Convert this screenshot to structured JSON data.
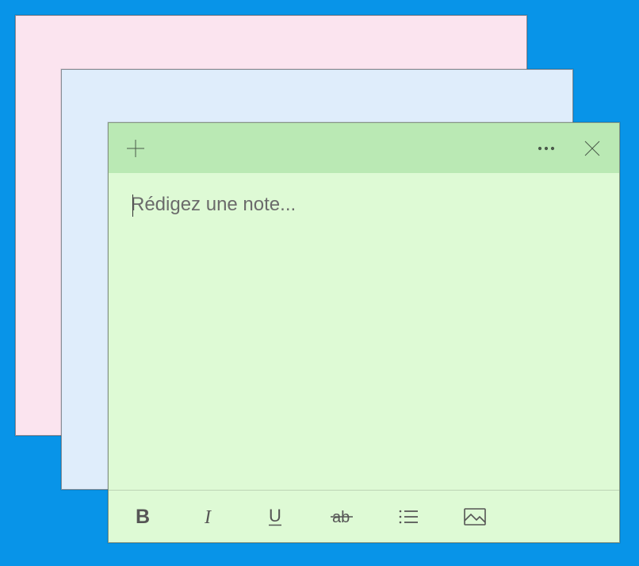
{
  "notes": {
    "back_pink": {
      "color": "#fbe4ef"
    },
    "back_blue": {
      "color": "#dfedfb"
    },
    "front_green": {
      "header_color": "#bae9b4",
      "body_color": "#defad5",
      "placeholder": "Rédigez une note...",
      "content": ""
    }
  },
  "titlebar": {
    "new_note": "new-note",
    "menu": "menu",
    "close": "close"
  },
  "toolbar": {
    "bold": "B",
    "italic": "I",
    "underline": "U",
    "strikethrough": "ab",
    "list": "list",
    "image": "image"
  }
}
